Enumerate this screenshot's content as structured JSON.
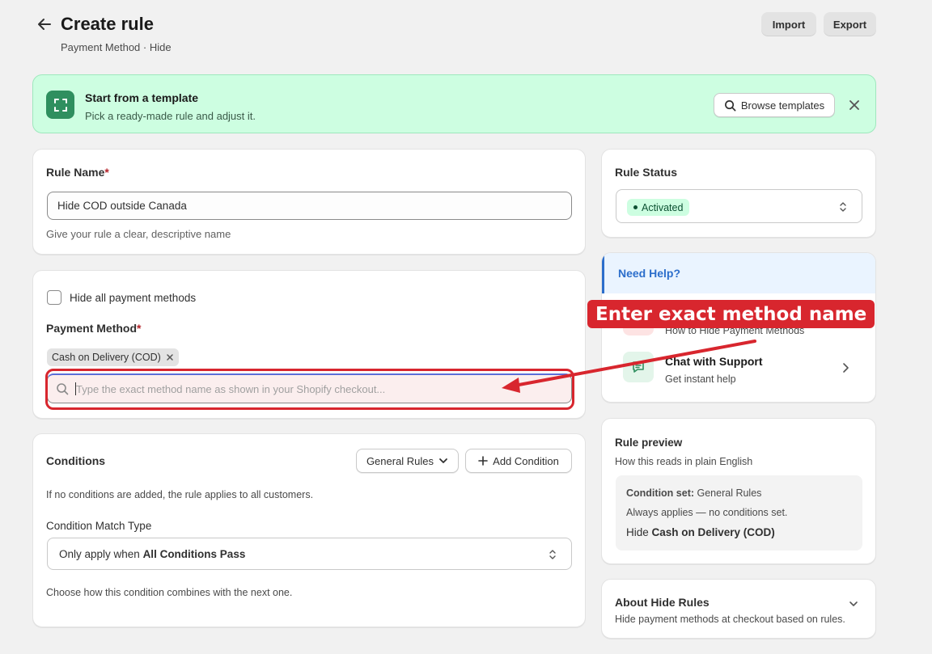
{
  "header": {
    "title": "Create rule",
    "breadcrumb": "Payment Method · Hide",
    "import_label": "Import",
    "export_label": "Export"
  },
  "template_banner": {
    "title": "Start from a template",
    "subtitle": "Pick a ready-made rule and adjust it.",
    "browse_label": "Browse templates"
  },
  "rule_name": {
    "label": "Rule Name",
    "required_mark": "*",
    "value": "Hide COD outside Canada",
    "help": "Give your rule a clear, descriptive name"
  },
  "payment_method": {
    "hide_all_label": "Hide all payment methods",
    "hide_all_checked": false,
    "label": "Payment Method",
    "required_mark": "*",
    "tags": [
      "Cash on Delivery (COD)"
    ],
    "search_placeholder": "Type the exact method name as shown in your Shopify checkout..."
  },
  "conditions": {
    "title": "Conditions",
    "general_rules_label": "General Rules",
    "add_condition_label": "Add Condition",
    "empty_note": "If no conditions are added, the rule applies to all customers.",
    "match_type_label": "Condition Match Type",
    "match_prefix": "Only apply when ",
    "match_value": "All Conditions Pass",
    "combine_help": "Choose how this condition combines with the next one."
  },
  "rule_status": {
    "title": "Rule Status",
    "value": "Activated",
    "badge_color": "#cdfee1"
  },
  "help": {
    "title": "Need Help?",
    "items": [
      {
        "title": "How to Hide Payment Methods",
        "subtitle": ""
      },
      {
        "title": "Chat with Support",
        "subtitle": "Get instant help"
      }
    ]
  },
  "preview": {
    "title": "Rule preview",
    "subtitle": "How this reads in plain English",
    "condition_set_label": "Condition set:",
    "condition_set_value": "General Rules",
    "always_line": "Always applies — no conditions set.",
    "hide_prefix": "Hide ",
    "hide_value": "Cash on Delivery (COD)"
  },
  "about": {
    "title": "About Hide Rules",
    "subtitle": "Hide payment methods at checkout based on rules."
  },
  "annotation": {
    "callout": "Enter exact method name",
    "color": "#d8262e"
  },
  "icons": {
    "back": "arrow-left-icon",
    "template": "frame-icon",
    "search": "search-icon",
    "close": "close-icon",
    "chat": "chat-icon",
    "chevron": "chevron-right-icon"
  }
}
